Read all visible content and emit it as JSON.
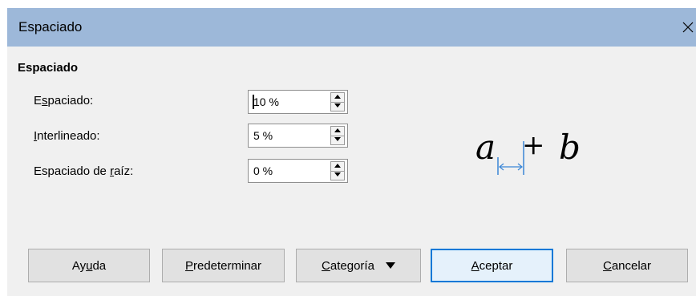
{
  "window": {
    "title": "Espaciado"
  },
  "section": {
    "title": "Espaciado"
  },
  "fields": [
    {
      "label_pre": "E",
      "label_u": "s",
      "label_post": "paciado:",
      "value": "10 %"
    },
    {
      "label_pre": "",
      "label_u": "I",
      "label_post": "nterlineado:",
      "value": "5 %"
    },
    {
      "label_pre": "Espaciado de ",
      "label_u": "r",
      "label_post": "aíz:",
      "value": "0 %"
    }
  ],
  "preview": {
    "a": "a",
    "plus": "+",
    "b": "b",
    "accent_color": "#3a86d6"
  },
  "buttons": {
    "help": {
      "pre": "Ay",
      "u": "u",
      "post": "da"
    },
    "default": {
      "pre": "",
      "u": "P",
      "post": "redeterminar"
    },
    "category": {
      "pre": "",
      "u": "C",
      "post": "ategoría"
    },
    "ok": {
      "pre": "",
      "u": "A",
      "post": "ceptar"
    },
    "cancel": {
      "pre": "",
      "u": "C",
      "post": "ancelar"
    }
  }
}
